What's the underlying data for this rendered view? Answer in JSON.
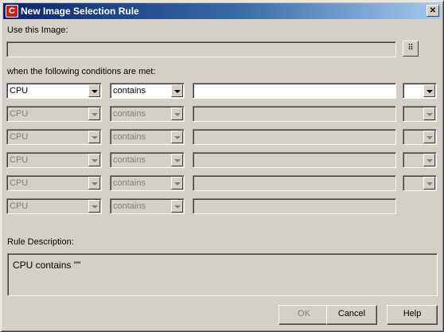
{
  "window": {
    "title": "New Image Selection Rule",
    "app_icon_glyph": "C",
    "close_glyph": "✕"
  },
  "labels": {
    "use_image": "Use this Image:",
    "conditions": "when the following conditions are met:",
    "rule_description": "Rule Description:"
  },
  "image_field": {
    "value": ""
  },
  "browse_button": {
    "icon": "tree-browse-icon",
    "glyph": "⠿"
  },
  "conditions": [
    {
      "attribute": "CPU",
      "operator": "contains",
      "value": "",
      "enabled": true,
      "has_extra": true
    },
    {
      "attribute": "CPU",
      "operator": "contains",
      "value": "",
      "enabled": false,
      "has_extra": true
    },
    {
      "attribute": "CPU",
      "operator": "contains",
      "value": "",
      "enabled": false,
      "has_extra": true
    },
    {
      "attribute": "CPU",
      "operator": "contains",
      "value": "",
      "enabled": false,
      "has_extra": true
    },
    {
      "attribute": "CPU",
      "operator": "contains",
      "value": "",
      "enabled": false,
      "has_extra": true
    },
    {
      "attribute": "CPU",
      "operator": "contains",
      "value": "",
      "enabled": false,
      "has_extra": false
    }
  ],
  "rule_description": "CPU contains \"\"",
  "buttons": {
    "ok": "OK",
    "cancel": "Cancel",
    "help": "Help"
  }
}
